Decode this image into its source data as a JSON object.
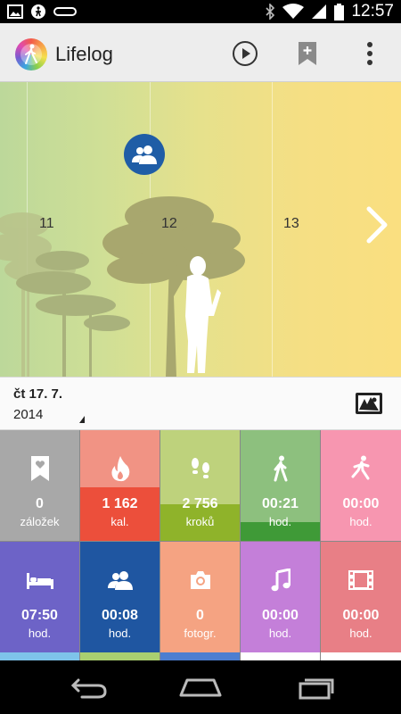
{
  "status_bar": {
    "time": "12:57",
    "left_icons": [
      "image-icon",
      "accessibility-icon",
      "band-icon"
    ],
    "right_icons": [
      "bluetooth-icon",
      "wifi-icon",
      "signal-icon",
      "battery-icon"
    ]
  },
  "action_bar": {
    "title": "Lifelog",
    "actions": [
      "play-icon",
      "bookmark-add-icon",
      "overflow-menu-icon"
    ]
  },
  "timeline": {
    "days": [
      "11",
      "12",
      "13"
    ],
    "badge_icon": "friends-icon",
    "next_icon": "chevron-right-icon"
  },
  "date": {
    "day": "čt 17. 7.",
    "year": "2014"
  },
  "tiles": [
    {
      "icon": "bookmark-heart-icon",
      "value": "0",
      "unit": "záložek",
      "bg": "#a8a8a8",
      "fill": "#a8a8a8",
      "progress": 0
    },
    {
      "icon": "flame-icon",
      "value": "1 162",
      "unit": "kal.",
      "bg": "#f19384",
      "fill": "#ec4f3b",
      "progress": 0.48
    },
    {
      "icon": "footsteps-icon",
      "value": "2 756",
      "unit": "kroků",
      "bg": "#bed27c",
      "fill": "#8fb32a",
      "progress": 0.33
    },
    {
      "icon": "walking-icon",
      "value": "00:21",
      "unit": "hod.",
      "bg": "#8dc07e",
      "fill": "#3f9a37",
      "progress": 0.17
    },
    {
      "icon": "running-icon",
      "value": "00:00",
      "unit": "hod.",
      "bg": "#f796b0",
      "fill": "#f796b0",
      "progress": 0
    },
    {
      "icon": "bed-icon",
      "value": "07:50",
      "unit": "hod.",
      "bg": "#6d63c7",
      "fill": "#6d63c7",
      "progress": 0
    },
    {
      "icon": "friends-icon",
      "value": "00:08",
      "unit": "hod.",
      "bg": "#1f56a1",
      "fill": "#1f56a1",
      "progress": 0
    },
    {
      "icon": "camera-icon",
      "value": "0",
      "unit": "fotogr.",
      "bg": "#f5a382",
      "fill": "#f5a382",
      "progress": 0
    },
    {
      "icon": "music-icon",
      "value": "00:00",
      "unit": "hod.",
      "bg": "#c47fd9",
      "fill": "#c47fd9",
      "progress": 0
    },
    {
      "icon": "film-icon",
      "value": "00:00",
      "unit": "hod.",
      "bg": "#e87f86",
      "fill": "#e87f86",
      "progress": 0
    }
  ],
  "bottom_strip_colors": [
    "#7ec3ea",
    "#a9cf70",
    "#4d7ed0",
    "#ffffff",
    "#ffffff"
  ],
  "nav_bar": [
    "back-icon",
    "home-icon",
    "recents-icon"
  ]
}
